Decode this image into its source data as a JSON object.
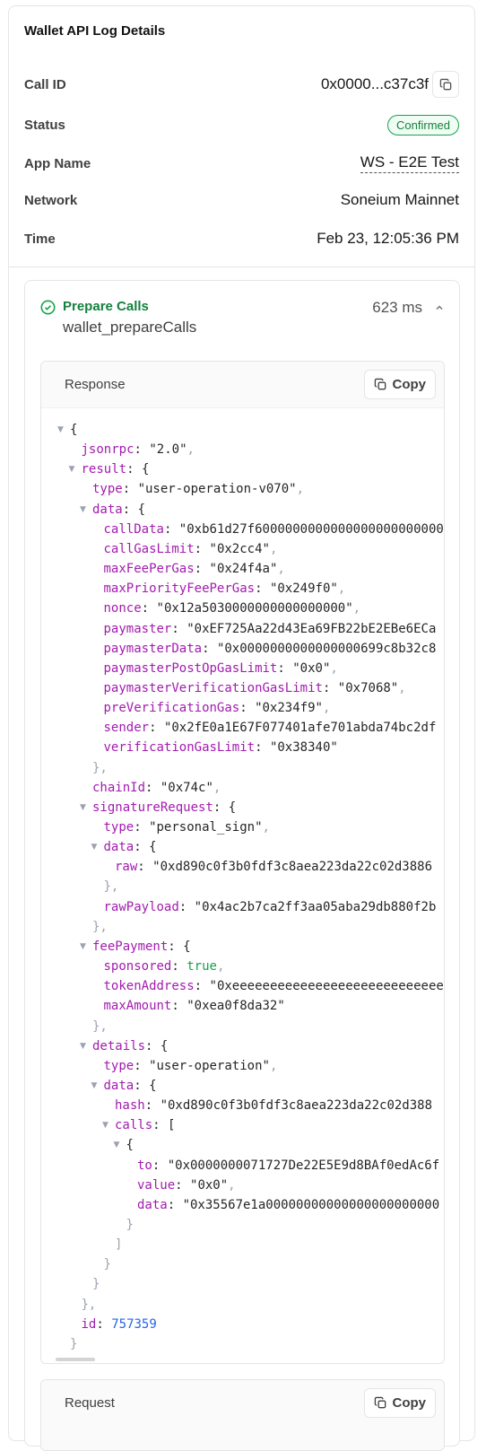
{
  "panel": {
    "title": "Wallet API Log Details"
  },
  "details": {
    "call_id_label": "Call ID",
    "call_id_value": "0x0000...c37c3f",
    "status_label": "Status",
    "status_value": "Confirmed",
    "app_name_label": "App Name",
    "app_name_value": "WS - E2E Test",
    "network_label": "Network",
    "network_value": "Soneium Mainnet",
    "time_label": "Time",
    "time_value": "Feb 23, 12:05:36 PM"
  },
  "call": {
    "label": "Prepare Calls",
    "method": "wallet_prepareCalls",
    "duration": "623 ms"
  },
  "response": {
    "title": "Response",
    "copy_label": "Copy",
    "lines": [
      {
        "d": 0,
        "t": 1,
        "k": "",
        "v": "{",
        "vt": "p"
      },
      {
        "d": 1,
        "t": 0,
        "k": "jsonrpc",
        "v": "\"2.0\"",
        "vt": "s",
        "c": ","
      },
      {
        "d": 1,
        "t": 1,
        "k": "result",
        "v": "{",
        "vt": "p"
      },
      {
        "d": 2,
        "t": 0,
        "k": "type",
        "v": "\"user-operation-v070\"",
        "vt": "s",
        "c": ","
      },
      {
        "d": 2,
        "t": 1,
        "k": "data",
        "v": "{",
        "vt": "p"
      },
      {
        "d": 3,
        "t": 0,
        "k": "callData",
        "v": "\"0xb61d27f60000000000000000000000000",
        "vt": "s"
      },
      {
        "d": 3,
        "t": 0,
        "k": "callGasLimit",
        "v": "\"0x2cc4\"",
        "vt": "s",
        "c": ","
      },
      {
        "d": 3,
        "t": 0,
        "k": "maxFeePerGas",
        "v": "\"0x24f4a\"",
        "vt": "s",
        "c": ","
      },
      {
        "d": 3,
        "t": 0,
        "k": "maxPriorityFeePerGas",
        "v": "\"0x249f0\"",
        "vt": "s",
        "c": ","
      },
      {
        "d": 3,
        "t": 0,
        "k": "nonce",
        "v": "\"0x12a5030000000000000000\"",
        "vt": "s",
        "c": ","
      },
      {
        "d": 3,
        "t": 0,
        "k": "paymaster",
        "v": "\"0xEF725Aa22d43Ea69FB22bE2EBe6ECa",
        "vt": "s"
      },
      {
        "d": 3,
        "t": 0,
        "k": "paymasterData",
        "v": "\"0x0000000000000000699c8b32c8",
        "vt": "s"
      },
      {
        "d": 3,
        "t": 0,
        "k": "paymasterPostOpGasLimit",
        "v": "\"0x0\"",
        "vt": "s",
        "c": ","
      },
      {
        "d": 3,
        "t": 0,
        "k": "paymasterVerificationGasLimit",
        "v": "\"0x7068\"",
        "vt": "s",
        "c": ","
      },
      {
        "d": 3,
        "t": 0,
        "k": "preVerificationGas",
        "v": "\"0x234f9\"",
        "vt": "s",
        "c": ","
      },
      {
        "d": 3,
        "t": 0,
        "k": "sender",
        "v": "\"0x2fE0a1E67F077401afe701abda74bc2df",
        "vt": "s"
      },
      {
        "d": 3,
        "t": 0,
        "k": "verificationGasLimit",
        "v": "\"0x38340\"",
        "vt": "s"
      },
      {
        "d": 2,
        "t": 0,
        "k": "",
        "v": "},",
        "vt": "g"
      },
      {
        "d": 2,
        "t": 0,
        "k": "chainId",
        "v": "\"0x74c\"",
        "vt": "s",
        "c": ","
      },
      {
        "d": 2,
        "t": 1,
        "k": "signatureRequest",
        "v": "{",
        "vt": "p"
      },
      {
        "d": 3,
        "t": 0,
        "k": "type",
        "v": "\"personal_sign\"",
        "vt": "s",
        "c": ","
      },
      {
        "d": 3,
        "t": 1,
        "k": "data",
        "v": "{",
        "vt": "p"
      },
      {
        "d": 4,
        "t": 0,
        "k": "raw",
        "v": "\"0xd890c0f3b0fdf3c8aea223da22c02d3886",
        "vt": "s"
      },
      {
        "d": 3,
        "t": 0,
        "k": "",
        "v": "},",
        "vt": "g"
      },
      {
        "d": 3,
        "t": 0,
        "k": "rawPayload",
        "v": "\"0x4ac2b7ca2ff3aa05aba29db880f2b",
        "vt": "s"
      },
      {
        "d": 2,
        "t": 0,
        "k": "",
        "v": "},",
        "vt": "g"
      },
      {
        "d": 2,
        "t": 1,
        "k": "feePayment",
        "v": "{",
        "vt": "p"
      },
      {
        "d": 3,
        "t": 0,
        "k": "sponsored",
        "v": "true",
        "vt": "b",
        "c": ","
      },
      {
        "d": 3,
        "t": 0,
        "k": "tokenAddress",
        "v": "\"0xeeeeeeeeeeeeeeeeeeeeeeeeeeee",
        "vt": "s"
      },
      {
        "d": 3,
        "t": 0,
        "k": "maxAmount",
        "v": "\"0xea0f8da32\"",
        "vt": "s"
      },
      {
        "d": 2,
        "t": 0,
        "k": "",
        "v": "},",
        "vt": "g"
      },
      {
        "d": 2,
        "t": 1,
        "k": "details",
        "v": "{",
        "vt": "p"
      },
      {
        "d": 3,
        "t": 0,
        "k": "type",
        "v": "\"user-operation\"",
        "vt": "s",
        "c": ","
      },
      {
        "d": 3,
        "t": 1,
        "k": "data",
        "v": "{",
        "vt": "p"
      },
      {
        "d": 4,
        "t": 0,
        "k": "hash",
        "v": "\"0xd890c0f3b0fdf3c8aea223da22c02d388",
        "vt": "s"
      },
      {
        "d": 4,
        "t": 1,
        "k": "calls",
        "v": "[",
        "vt": "p"
      },
      {
        "d": 5,
        "t": 1,
        "k": "",
        "v": "{",
        "vt": "p"
      },
      {
        "d": 6,
        "t": 0,
        "k": "to",
        "v": "\"0x0000000071727De22E5E9d8BAf0edAc6f",
        "vt": "s"
      },
      {
        "d": 6,
        "t": 0,
        "k": "value",
        "v": "\"0x0\"",
        "vt": "s",
        "c": ","
      },
      {
        "d": 6,
        "t": 0,
        "k": "data",
        "v": "\"0x35567e1a00000000000000000000000",
        "vt": "s"
      },
      {
        "d": 5,
        "t": 0,
        "k": "",
        "v": "}",
        "vt": "g"
      },
      {
        "d": 4,
        "t": 0,
        "k": "",
        "v": "]",
        "vt": "g"
      },
      {
        "d": 3,
        "t": 0,
        "k": "",
        "v": "}",
        "vt": "g"
      },
      {
        "d": 2,
        "t": 0,
        "k": "",
        "v": "}",
        "vt": "g"
      },
      {
        "d": 1,
        "t": 0,
        "k": "",
        "v": "},",
        "vt": "g"
      },
      {
        "d": 1,
        "t": 0,
        "k": "id",
        "v": "757359",
        "vt": "n"
      },
      {
        "d": 0,
        "t": 0,
        "k": "",
        "v": "}",
        "vt": "g"
      }
    ]
  },
  "request_section": {
    "title": "Request",
    "copy_label": "Copy"
  }
}
